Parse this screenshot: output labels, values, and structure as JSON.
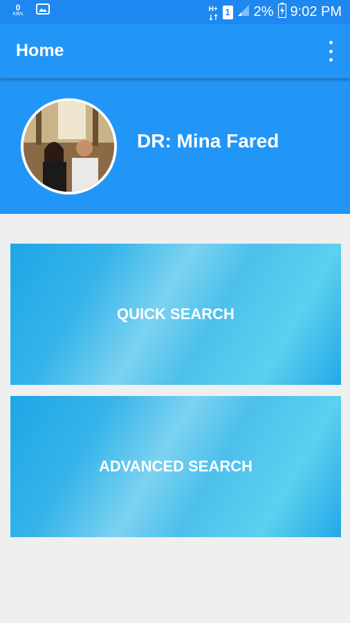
{
  "status_bar": {
    "network_speed_value": "0",
    "network_speed_unit": "KB/s",
    "network_type": "H+",
    "sim_slot": "1",
    "battery": "2%",
    "time": "9:02 PM",
    "icons": [
      "gallery-icon",
      "network-type-icon",
      "sim-icon",
      "signal-icon",
      "battery-charging-icon"
    ]
  },
  "appbar": {
    "title": "Home",
    "menu_icon": "overflow-menu-icon"
  },
  "profile": {
    "name": "DR: Mina Fared"
  },
  "actions": {
    "quick_search": "QUICK SEARCH",
    "advanced_search": "ADVANCED SEARCH"
  },
  "colors": {
    "primary": "#2196f7",
    "status_bar": "#1e88f0",
    "background": "#efefef",
    "card_accent": "#36b4ea"
  }
}
